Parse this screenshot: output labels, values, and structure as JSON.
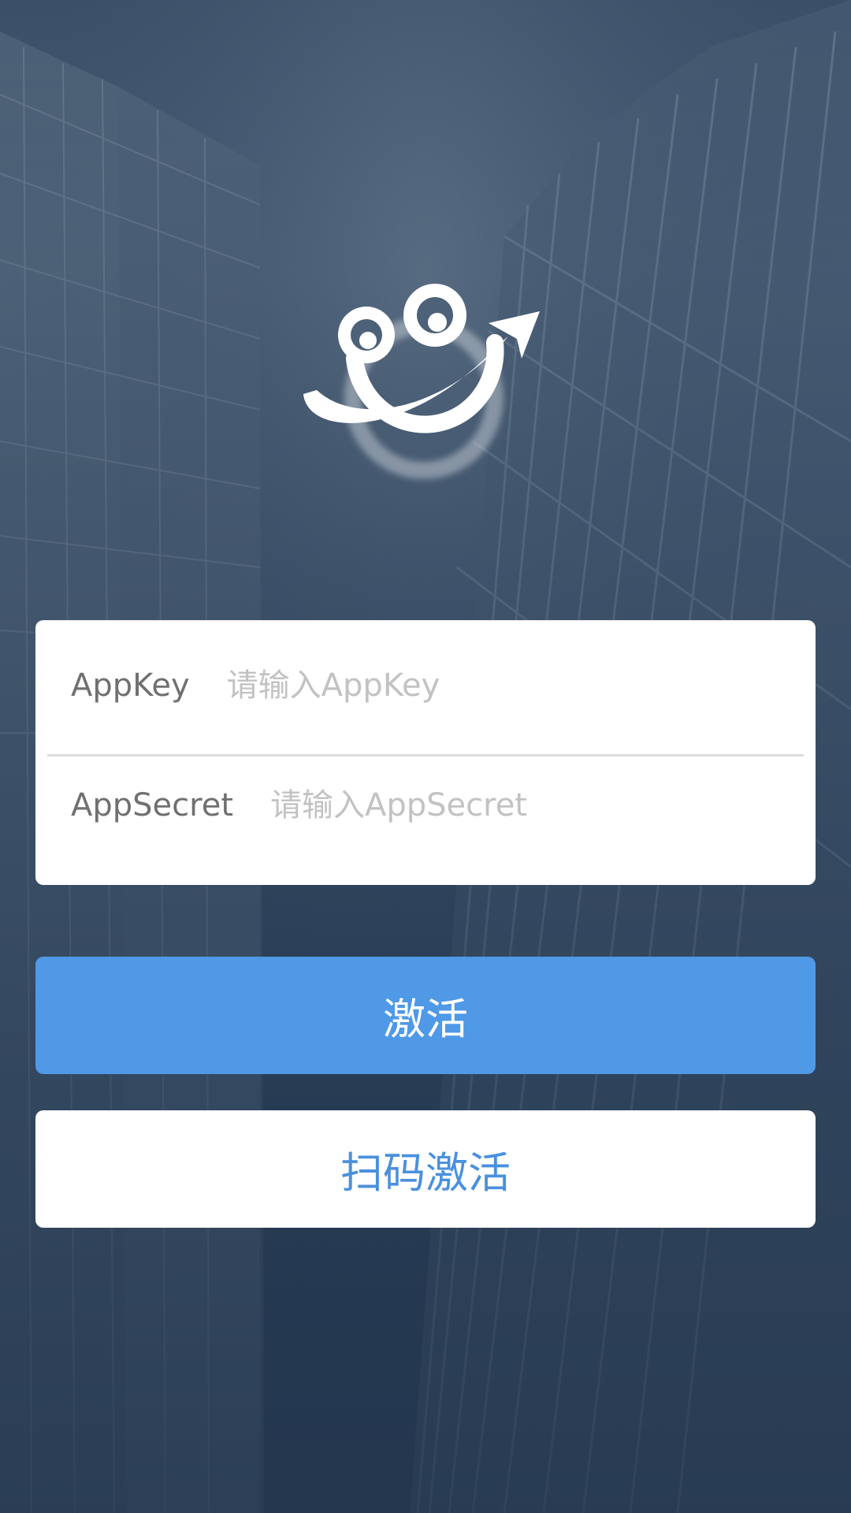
{
  "logo": {
    "icon": "smiley-frog-logo-icon"
  },
  "form": {
    "appkey_label": "AppKey",
    "appkey_placeholder": "请输入AppKey",
    "appkey_value": "",
    "appsecret_label": "AppSecret",
    "appsecret_placeholder": "请输入AppSecret",
    "appsecret_value": ""
  },
  "buttons": {
    "activate_label": "激活",
    "scan_activate_label": "扫码激活"
  },
  "colors": {
    "primary": "#4f99e6",
    "background": "#3a5068",
    "card": "#ffffff"
  }
}
